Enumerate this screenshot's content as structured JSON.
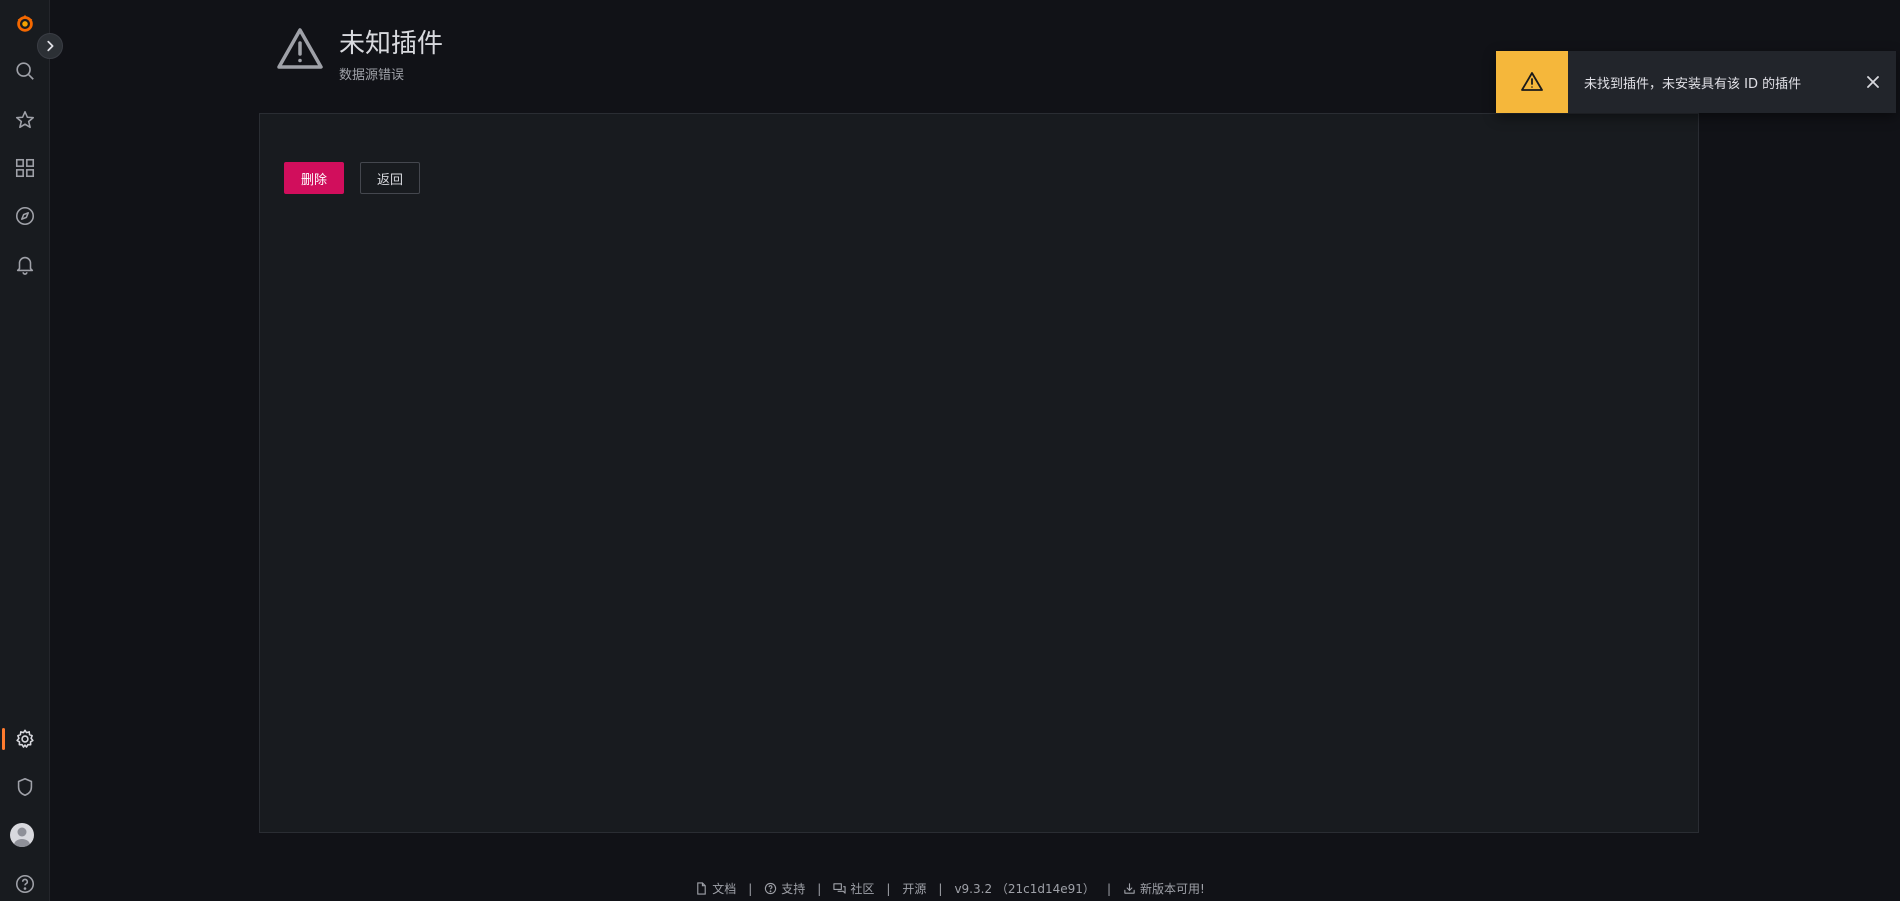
{
  "sidebar": {
    "icons": [
      "grafana-logo-icon",
      "search-icon",
      "star-icon",
      "dashboards-icon",
      "explore-compass-icon",
      "alert-bell-icon",
      "gear-icon",
      "shield-icon",
      "user-avatar",
      "help-icon"
    ],
    "active_item": "gear-icon",
    "active_color": "#ff7b2e"
  },
  "header": {
    "title": "未知插件",
    "subtitle": "数据源错误"
  },
  "actions": {
    "delete_label": "删除",
    "back_label": "返回"
  },
  "toast": {
    "message": "未找到插件，未安装具有该 ID 的插件",
    "accent_color": "#f5b73b"
  },
  "footer": {
    "docs": "文档",
    "support": "支持",
    "community": "社区",
    "open_source": "开源",
    "version": "v9.3.2 （21c1d14e91）",
    "new_version": "新版本可用!"
  },
  "colors": {
    "background": "#111217",
    "panel": "#181b1f",
    "delete_button": "#d10e5c"
  }
}
